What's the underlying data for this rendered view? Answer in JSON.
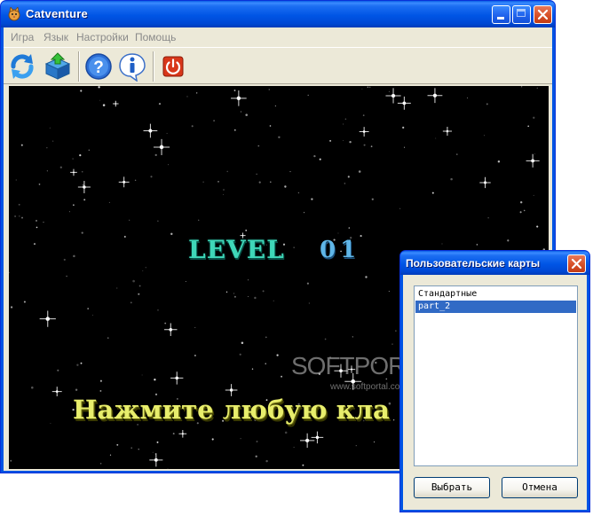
{
  "window": {
    "title": "Catventure",
    "app_icon": "cat-icon"
  },
  "menu": {
    "items": [
      "Игра",
      "Язык",
      "Настройки",
      "Помощь"
    ]
  },
  "toolbar": {
    "buttons": [
      {
        "name": "restart-icon"
      },
      {
        "name": "load-map-icon"
      },
      {
        "name": "help-icon"
      },
      {
        "name": "info-icon"
      },
      {
        "name": "power-icon"
      }
    ]
  },
  "game": {
    "level_label": "LEVEL",
    "level_number": "01",
    "prompt": "Нажмите любую кла",
    "watermark": "SOFTPORTAL",
    "watermark_url": "www.softportal.com"
  },
  "dialog": {
    "title": "Пользовательские карты",
    "maps": [
      "Стандартные",
      "part_2"
    ],
    "selected_index": 1,
    "select_label": "Выбрать",
    "cancel_label": "Отмена"
  },
  "colors": {
    "title_bar": "#0054e3",
    "level_text": "#3fd7b8",
    "level_number": "#5fb6e8",
    "prompt_text": "#e8ee6c",
    "selection": "#316ac5"
  }
}
